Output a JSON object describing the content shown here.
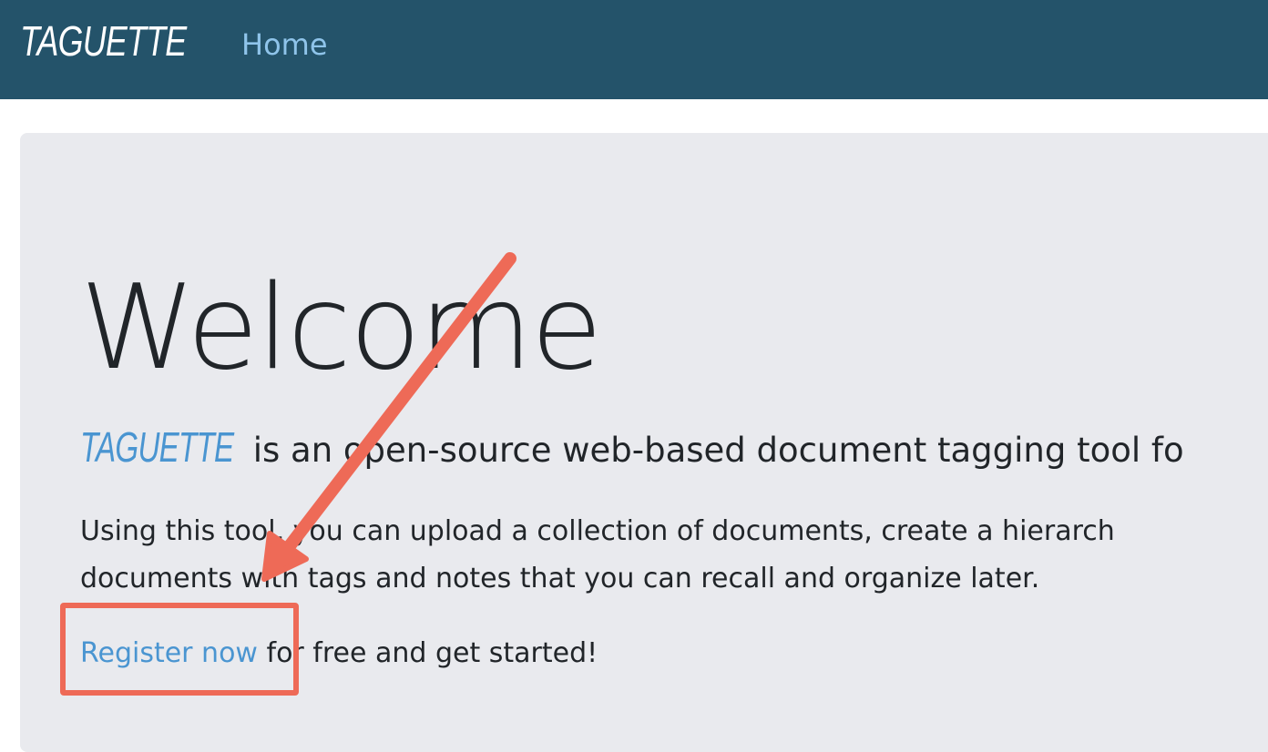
{
  "navbar": {
    "brand": "TAGUETTE",
    "home_link": "Home"
  },
  "main": {
    "heading": "Welcome",
    "lead_brand": "TAGUETTE",
    "lead_text": "is an open-source web-based document tagging tool fo",
    "paragraph": "Using this tool, you can upload a collection of documents, create a hierarch documents with tags and notes that you can recall and organize later.",
    "cta_link": "Register now",
    "cta_text": " for free and get started!"
  },
  "annotation": {
    "color": "#ee6a57",
    "type": "arrow-and-box",
    "target": "register-link"
  },
  "colors": {
    "navbar_bg": "#24536a",
    "link": "#4a95d1",
    "nav_link": "#8fc4ea",
    "jumbotron_bg": "#e9eaee"
  }
}
